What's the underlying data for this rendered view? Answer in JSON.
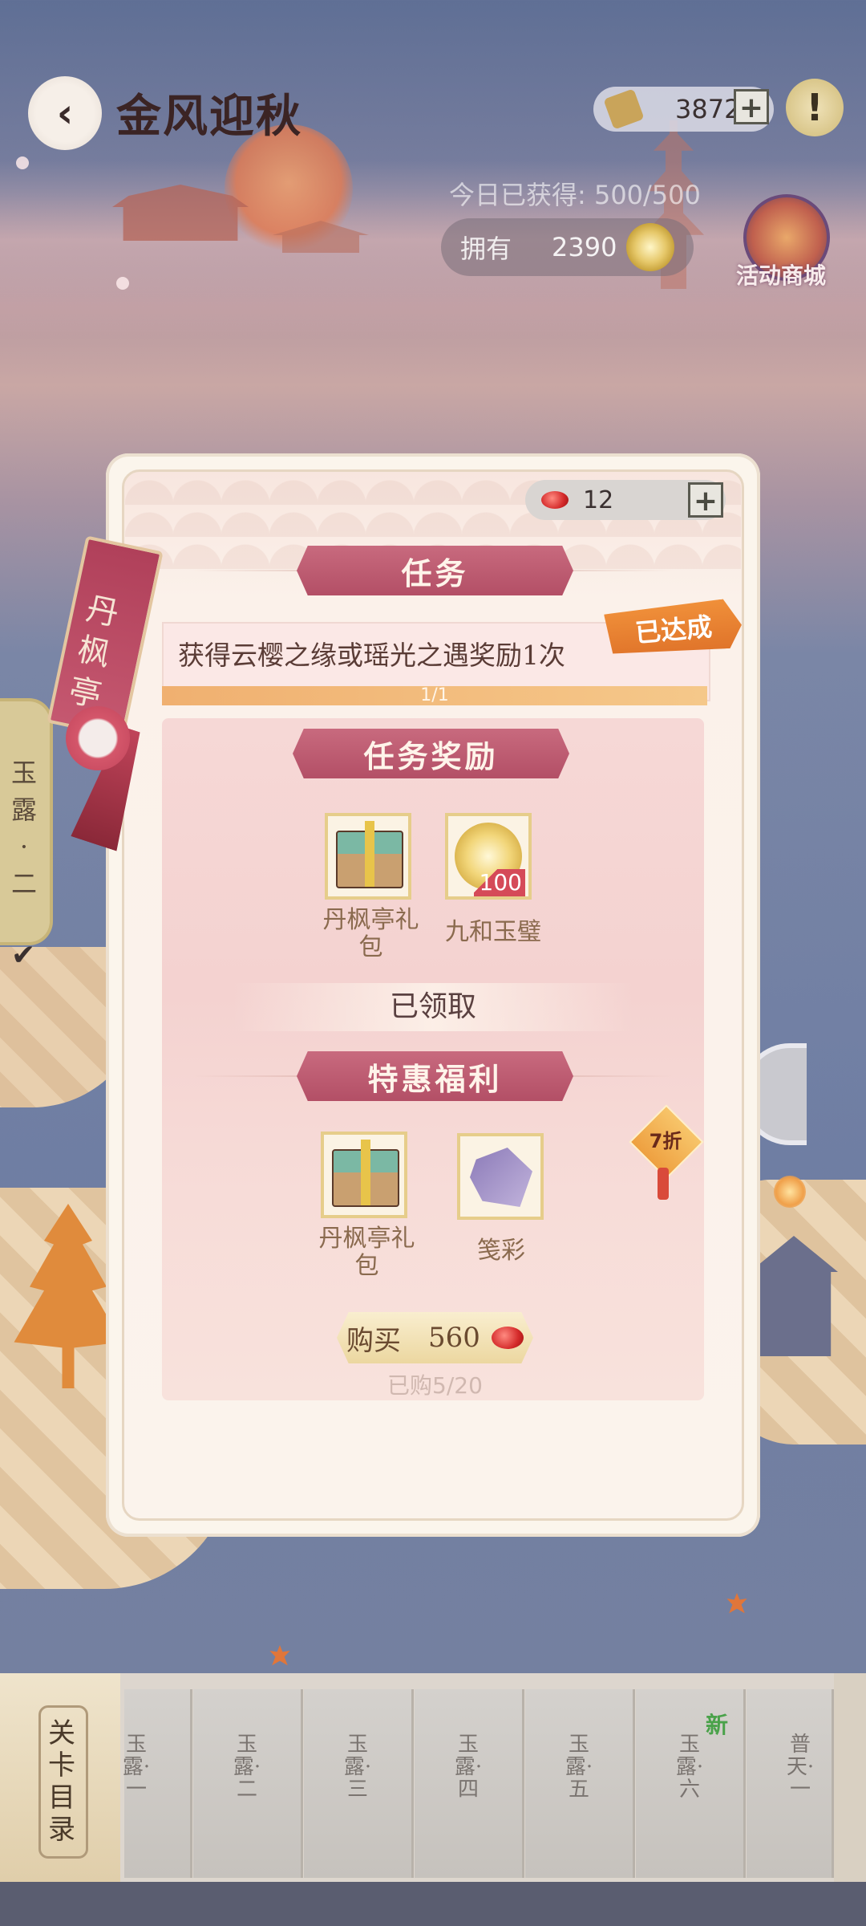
{
  "header": {
    "title": "金风迎秋",
    "back_icon": "‹",
    "tickets": "38726",
    "plus": "+",
    "info": "!",
    "today_earned": "今日已获得: 500/500",
    "own_label": "拥有",
    "own_value": "2390",
    "shop_label": "活动商城"
  },
  "side_tag": {
    "text": "玉露·二",
    "check": "✔"
  },
  "panel": {
    "location_tag": "丹枫亭",
    "gems": "12",
    "gem_plus": "+",
    "task_section": "任务",
    "task_text": "获得云樱之缘或瑶光之遇奖励1次",
    "task_progress": "1/1",
    "task_progress_fraction": 1.0,
    "status_badge": "已达成",
    "reward_section": "任务奖励",
    "rewards": [
      {
        "name": "丹枫亭礼包",
        "icon": "gift-box-icon"
      },
      {
        "name": "九和玉璧",
        "icon": "jade-disc-icon",
        "count": "100"
      }
    ],
    "claimed": "已领取",
    "offer_section": "特惠福利",
    "discount": "7折",
    "offer_items": [
      {
        "name": "丹枫亭礼包",
        "icon": "gift-box-icon"
      },
      {
        "name": "笺彩",
        "icon": "letters-icon"
      }
    ],
    "buy_label": "购买",
    "buy_price": "560",
    "bought": "已购5/20"
  },
  "stages": {
    "catalog": "关卡目录",
    "new_badge": "新",
    "items": [
      "玉露·一",
      "玉露·二",
      "玉露·三",
      "玉露·四",
      "玉露·五",
      "玉露·六",
      "普天·一"
    ]
  },
  "colors": {
    "ribbon": "#b34f66",
    "badge": "#e0742a",
    "gold": "#e6cd8a",
    "panel": "#fbf5ec"
  }
}
